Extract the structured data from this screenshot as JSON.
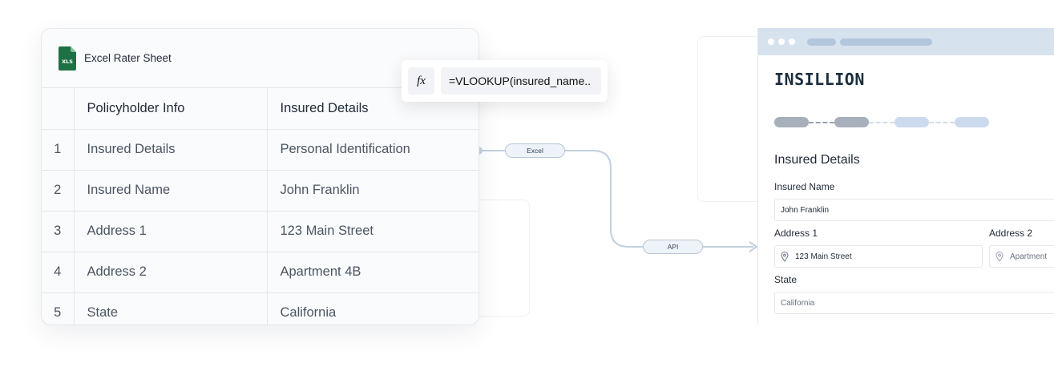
{
  "sheet": {
    "title": "Excel Rater Sheet",
    "icon": "xls-file-icon",
    "icon_text": "XLS",
    "columns": [
      "",
      "Policyholder Info",
      "Insured Details"
    ],
    "rows": [
      {
        "num": "1",
        "field": "Insured Details",
        "value": "Personal Identification"
      },
      {
        "num": "2",
        "field": "Insured Name",
        "value": "John Franklin"
      },
      {
        "num": "3",
        "field": "Address 1",
        "value": "123 Main Street"
      },
      {
        "num": "4",
        "field": "Address 2",
        "value": "Apartment 4B"
      },
      {
        "num": "5",
        "field": "State",
        "value": "California"
      }
    ]
  },
  "formula": {
    "fx_label": "fx",
    "text": "=VLOOKUP(insured_name.."
  },
  "connector": {
    "excel_label": "Excel",
    "api_label": "API"
  },
  "app": {
    "logo": "INSILLION",
    "form_title": "Insured Details",
    "steps": [
      {
        "state": "done"
      },
      {
        "state": "done"
      },
      {
        "state": "todo"
      },
      {
        "state": "todo"
      }
    ],
    "fields": {
      "insured_name_label": "Insured Name",
      "insured_name_value": "John Franklin",
      "address1_label": "Address 1",
      "address1_value": "123 Main Street",
      "address2_label": "Address 2",
      "address2_placeholder": "Apartment",
      "state_label": "State",
      "state_value": "California"
    }
  },
  "colors": {
    "excel_green": "#1e7145",
    "browser_bar": "#d7e2ef",
    "connector": "#c3d0de"
  }
}
